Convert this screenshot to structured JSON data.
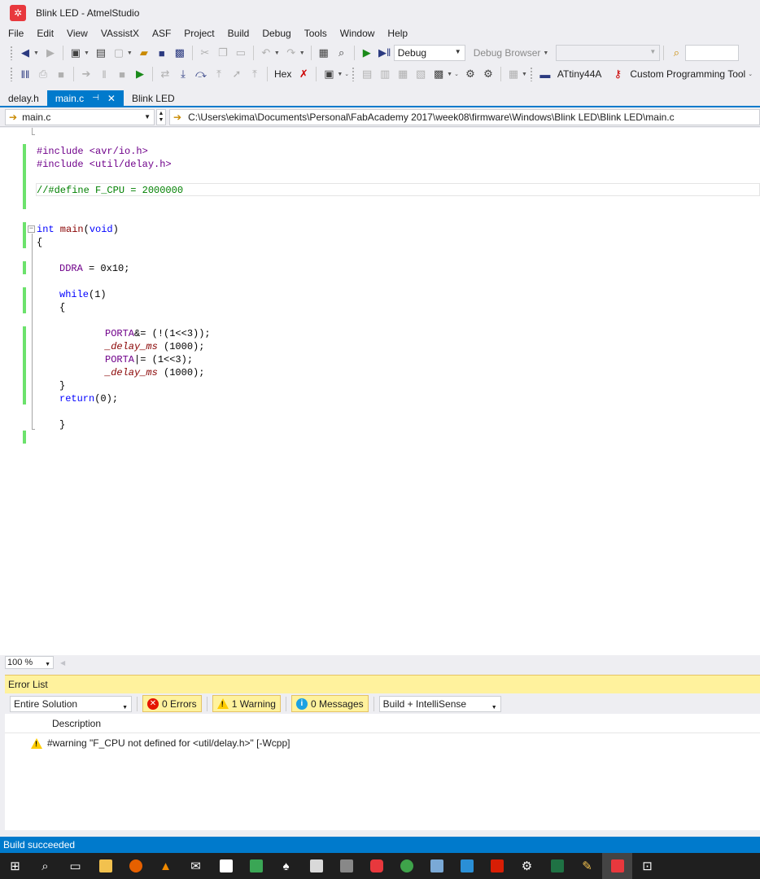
{
  "window": {
    "title": "Blink LED - AtmelStudio"
  },
  "menu": [
    "File",
    "Edit",
    "View",
    "VAssistX",
    "ASF",
    "Project",
    "Build",
    "Debug",
    "Tools",
    "Window",
    "Help"
  ],
  "toolbar1": {
    "config": "Debug",
    "debug_browser": "Debug Browser"
  },
  "toolbar2": {
    "hex_label": "Hex",
    "device": "ATtiny44A",
    "tool": "Custom Programming Tool"
  },
  "tabs": [
    {
      "label": "delay.h",
      "active": false
    },
    {
      "label": "main.c",
      "active": true
    },
    {
      "label": "Blink LED",
      "active": false
    }
  ],
  "nav": {
    "file": "main.c",
    "path": "C:\\Users\\ekima\\Documents\\Personal\\FabAcademy 2017\\week08\\firmware\\Windows\\Blink LED\\Blink LED\\main.c"
  },
  "code": {
    "l1": "#include <avr/io.h>",
    "l2": "#include <util/delay.h>",
    "l3": "//#define F_CPU = 2000000",
    "main_kw": "int",
    "main_fn": " main",
    "main_args": "(",
    "main_void": "void",
    "main_close": ")",
    "brace_open": "{",
    "ddra": "DDRA",
    "ddra_rest": " = 0x10;",
    "while_kw": "while",
    "while_rest": "(1)",
    "brace_open2": "{",
    "porta1": "PORTA",
    "porta1_rest": "&= (!(1<<3));",
    "delay1": "_delay_ms",
    "delay1_rest": " (1000);",
    "porta2": "PORTA",
    "porta2_rest": "|= (1<<3);",
    "delay2": "_delay_ms",
    "delay2_rest": " (1000);",
    "brace_close2": "}",
    "return_kw": "return",
    "return_rest": "(0);",
    "brace_close": "}"
  },
  "zoom": "100 %",
  "error_list": {
    "title": "Error List",
    "scope": "Entire Solution",
    "errors": "0 Errors",
    "warnings": "1 Warning",
    "messages": "0 Messages",
    "source": "Build + IntelliSense",
    "col_description": "Description",
    "rows": [
      {
        "type": "warning",
        "description": "#warning \"F_CPU not defined for <util/delay.h>\" [-Wcpp]"
      }
    ]
  },
  "status": "Build succeeded",
  "taskbar": [
    "windows-start",
    "search",
    "task-view",
    "file-explorer",
    "firefox",
    "vlc",
    "mail",
    "notepad",
    "app-green",
    "solitaire",
    "notes",
    "app-dark",
    "app-red",
    "browser",
    "photos",
    "app-blue",
    "acrobat",
    "settings",
    "excel",
    "paint",
    "atmel-studio",
    "store"
  ]
}
